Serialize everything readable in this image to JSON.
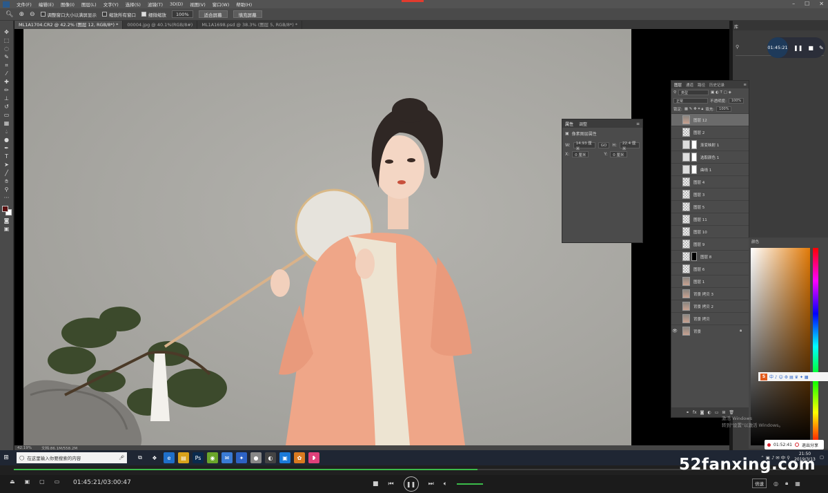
{
  "menubar": {
    "items": [
      "文件(F)",
      "编辑(E)",
      "图像(I)",
      "图层(L)",
      "文字(Y)",
      "选择(S)",
      "滤镜(T)",
      "3D(D)",
      "视图(V)",
      "窗口(W)",
      "帮助(H)"
    ],
    "window_controls": [
      "–",
      "☐",
      "✕"
    ]
  },
  "options": {
    "checkbox1_label": "调整窗口大小以满屏显示",
    "checkbox2_label": "缩放所有窗口",
    "checkbox3_label": "细微缩放",
    "zoom_value": "100%",
    "fit_button": "适合屏幕",
    "fill_button": "填充屏幕"
  },
  "tabs": [
    "ML1A1704.CR2 @ 42.2% (图层 12, RGB/8*) *",
    "00004.jpg @ 40.1%(RGB/8#)",
    "ML1A1698.psd @ 38.3% (图层 5, RGB/8*) *"
  ],
  "status": {
    "zoom": "42.19%",
    "doc": "文档:86.1M/558.2M"
  },
  "properties": {
    "tab1": "属性",
    "tab2": "调整",
    "header": "像素图层属性",
    "w_label": "W:",
    "w_value": "14.93 厘米",
    "go": "GO",
    "h_label": "H:",
    "h_value": "22.4 厘米",
    "x_label": "X:",
    "x_value": "0 厘米",
    "y_label": "Y:",
    "y_value": "0 厘米"
  },
  "layers_panel": {
    "tabs": [
      "图层",
      "通道",
      "路径",
      "历史记录"
    ],
    "filter": "类型",
    "blend": "正常",
    "opacity_label": "不透明度:",
    "opacity": "100%",
    "lock_label": "锁定:",
    "fill_label": "填充:",
    "fill": "100%",
    "items": [
      {
        "name": "图层 12",
        "thumb": "photo",
        "selected": true
      },
      {
        "name": "图层 2",
        "thumb": "trans"
      },
      {
        "name": "渐变映射 1",
        "thumb": "adj"
      },
      {
        "name": "选取颜色 1",
        "thumb": "adj"
      },
      {
        "name": "曲线 1",
        "thumb": "adj"
      },
      {
        "name": "图层 4",
        "thumb": "trans"
      },
      {
        "name": "图层 3",
        "thumb": "trans"
      },
      {
        "name": "图层 5",
        "thumb": "trans"
      },
      {
        "name": "图层 11",
        "thumb": "trans"
      },
      {
        "name": "图层 10",
        "thumb": "trans"
      },
      {
        "name": "图层 9",
        "thumb": "trans"
      },
      {
        "name": "图层 8",
        "thumb": "mask"
      },
      {
        "name": "图层 6",
        "thumb": "trans"
      },
      {
        "name": "图层 1",
        "thumb": "photo"
      },
      {
        "name": "背景 拷贝 3",
        "thumb": "photo"
      },
      {
        "name": "背景 拷贝 2",
        "thumb": "photo"
      },
      {
        "name": "背景 拷贝",
        "thumb": "photo"
      },
      {
        "name": "背景",
        "thumb": "photo",
        "visible": true,
        "locked": true
      }
    ]
  },
  "color_panel": {
    "title": "颜色"
  },
  "dock": {
    "tab": "库"
  },
  "recorder": {
    "time": "01:45:21"
  },
  "activation": {
    "line1": "激活 Windows",
    "line2": "转到\"设置\"以激活 Windows。"
  },
  "share": {
    "time": "01:52:41",
    "label": "退出分享"
  },
  "taskbar": {
    "search_placeholder": "在这里输入你要搜索的内容",
    "clock_time": "21:50",
    "clock_date": "2019/3/13",
    "apps": [
      {
        "icon": "task-view-icon",
        "glyph": "⧉",
        "color": "#1f2633"
      },
      {
        "icon": "store-icon",
        "glyph": "❖",
        "color": "#1f2633"
      },
      {
        "icon": "edge-icon",
        "glyph": "e",
        "color": "#1f6fc9"
      },
      {
        "icon": "explorer-icon",
        "glyph": "▤",
        "color": "#d9a21b"
      },
      {
        "icon": "photoshop-icon",
        "glyph": "Ps",
        "color": "#0a2a4d"
      },
      {
        "icon": "browser-icon",
        "glyph": "◉",
        "color": "#6aa52a"
      },
      {
        "icon": "mail-icon",
        "glyph": "✉",
        "color": "#3a7bd5"
      },
      {
        "icon": "email-client-icon",
        "glyph": "✦",
        "color": "#2d62c4"
      },
      {
        "icon": "avatar-app-icon",
        "glyph": "●",
        "color": "#888888"
      },
      {
        "icon": "media-icon",
        "glyph": "◐",
        "color": "#444444"
      },
      {
        "icon": "screen-record-icon",
        "glyph": "▣",
        "color": "#1a7ad9"
      },
      {
        "icon": "wechat-icon",
        "glyph": "✿",
        "color": "#d97a20"
      },
      {
        "icon": "chat-icon",
        "glyph": "❥",
        "color": "#e0407a"
      }
    ]
  },
  "player": {
    "time": "01:45:21/03:00:47",
    "progress": 0.583,
    "speed": "倍速"
  },
  "watermark": "52fanxing.com"
}
